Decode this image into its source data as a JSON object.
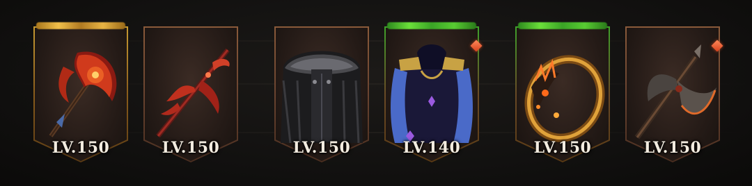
{
  "items": [
    {
      "name": "flame-axe",
      "level": "LV.150",
      "rarity": "gold"
    },
    {
      "name": "crimson-staff",
      "level": "LV.150",
      "rarity": "copper"
    },
    {
      "name": "fur-cloak",
      "level": "LV.150",
      "rarity": "copper"
    },
    {
      "name": "sapphire-cape",
      "level": "LV.140",
      "rarity": "green",
      "badge": true
    },
    {
      "name": "ember-ring",
      "level": "LV.150",
      "rarity": "green"
    },
    {
      "name": "battle-axe",
      "level": "LV.150",
      "rarity": "copper",
      "badge": true
    }
  ],
  "colors": {
    "gold_rim": "#f2c04a",
    "green_rim": "#6be03a",
    "badge": "#e5552a",
    "level_text": "#f3ece0"
  }
}
